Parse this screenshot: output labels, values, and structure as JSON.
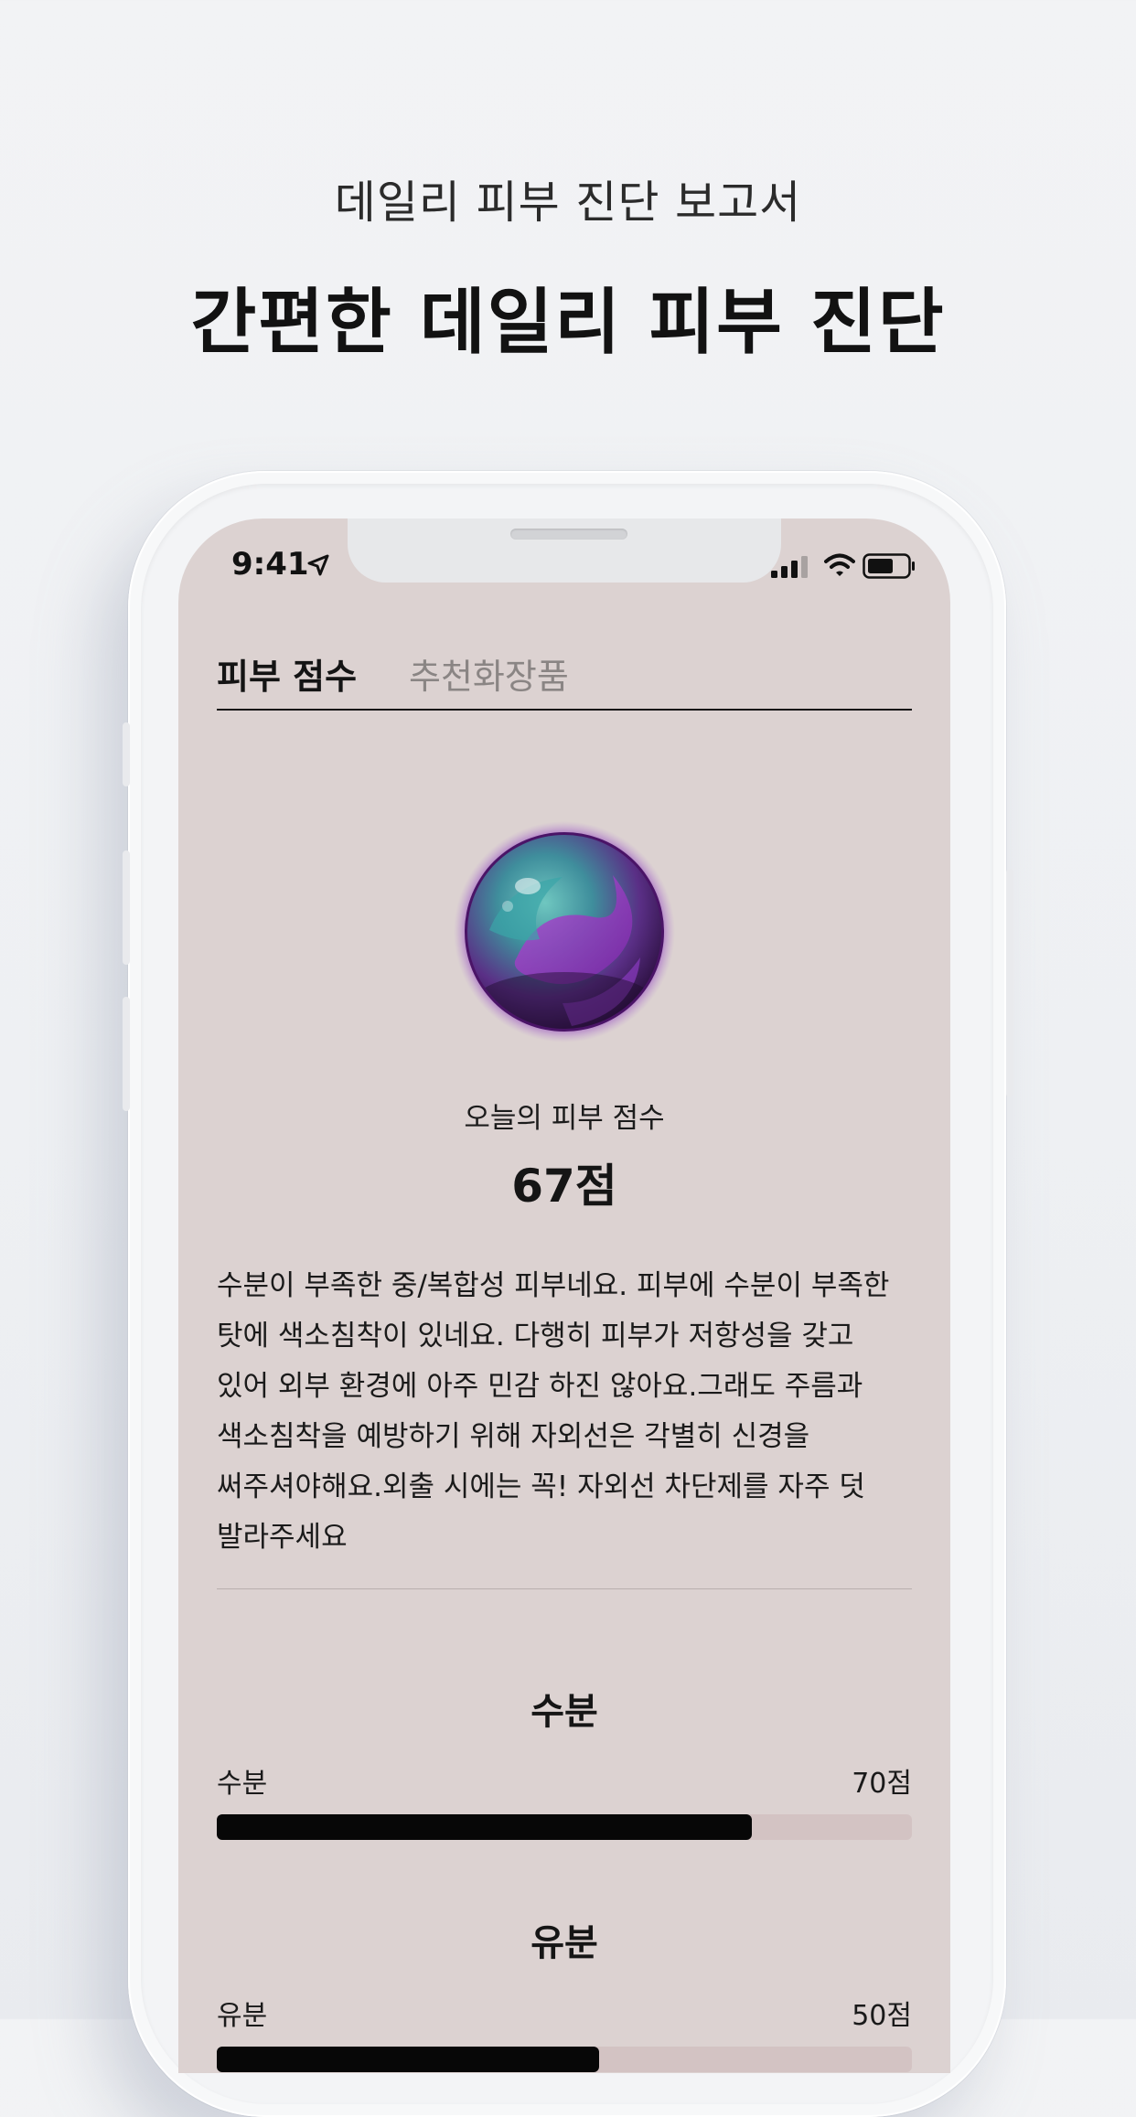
{
  "promo": {
    "subtitle": "데일리 피부 진단 보고서",
    "title": "간편한 데일리 피부 진단"
  },
  "status_bar": {
    "time": "9:41",
    "icons": [
      "location-arrow-icon",
      "signal-icon",
      "wifi-icon",
      "battery-icon"
    ]
  },
  "tabs": [
    {
      "label": "피부 점수",
      "active": true
    },
    {
      "label": "추천화장품",
      "active": false
    }
  ],
  "score": {
    "label": "오늘의 피부 점수",
    "value": "67점"
  },
  "description": "수분이 부족한 중/복합성 피부네요. 피부에 수분이 부족한 탓에 색소침착이 있네요. 다행히 피부가 저항성을 갖고 있어 외부 환경에 아주 민감 하진 않아요.그래도 주름과 색소침착을 예방하기 위해 자외선은 각별히 신경을 써주셔야해요.외출 시에는 꼭! 자외선 차단제를 자주 덧 발라주세요",
  "metrics": [
    {
      "section": "수분",
      "name": "수분",
      "score_text": "70점",
      "value": 70
    },
    {
      "section": "유분",
      "name": "유분",
      "score_text": "50점",
      "value": 50
    }
  ],
  "colors": {
    "screen_bg": "#dcd2d1",
    "bar_fill": "#070707",
    "bar_track": "#d3c3c3",
    "orb_glow": "#7a2fa6"
  }
}
